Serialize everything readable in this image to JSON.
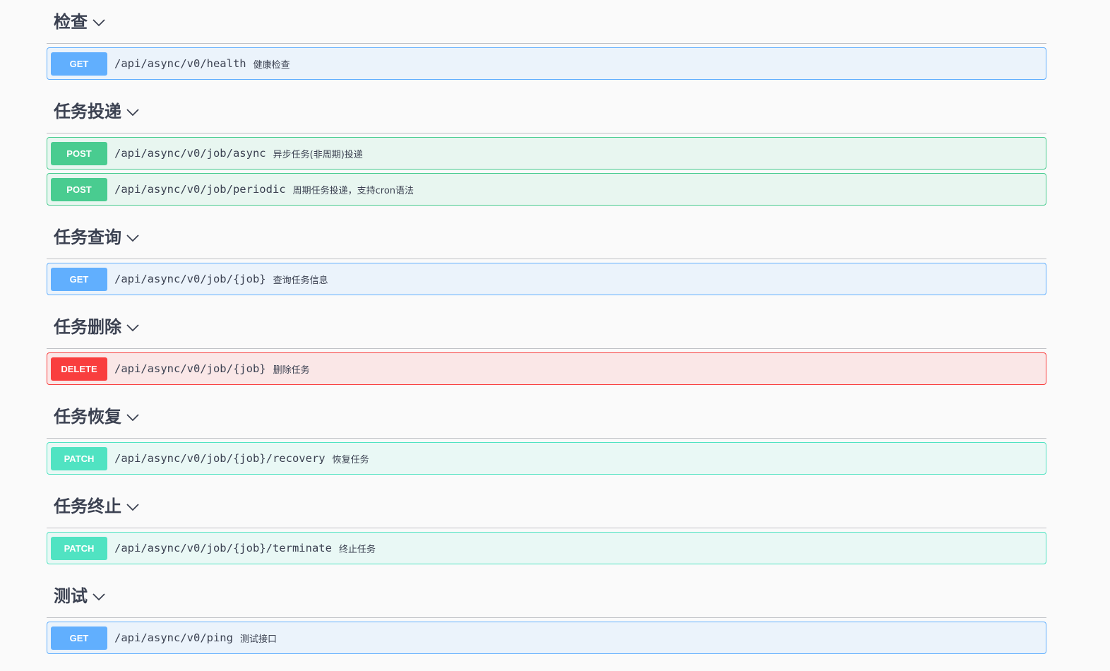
{
  "colors": {
    "get": {
      "bg": "#ebf3fb",
      "border": "#61affe",
      "badge": "#61affe"
    },
    "post": {
      "bg": "#e8f6f0",
      "border": "#49cc90",
      "badge": "#49cc90"
    },
    "delete": {
      "bg": "#fae7e7",
      "border": "#f93e3e",
      "badge": "#f93e3e"
    },
    "patch": {
      "bg": "#e9f8f5",
      "border": "#50e3c2",
      "badge": "#50e3c2"
    }
  },
  "tags": [
    {
      "name": "检查",
      "icon": "chevron-down-icon",
      "operations": [
        {
          "method": "GET",
          "type": "get",
          "path": "/api/async/v0/health",
          "summary": "健康检查"
        }
      ]
    },
    {
      "name": "任务投递",
      "icon": "chevron-down-icon",
      "operations": [
        {
          "method": "POST",
          "type": "post",
          "path": "/api/async/v0/job/async",
          "summary": "异步任务(非周期)投递"
        },
        {
          "method": "POST",
          "type": "post",
          "path": "/api/async/v0/job/periodic",
          "summary": "周期任务投递，支持cron语法"
        }
      ]
    },
    {
      "name": "任务查询",
      "icon": "chevron-down-icon",
      "operations": [
        {
          "method": "GET",
          "type": "get",
          "path": "/api/async/v0/job/{job}",
          "summary": "查询任务信息"
        }
      ]
    },
    {
      "name": "任务删除",
      "icon": "chevron-down-icon",
      "operations": [
        {
          "method": "DELETE",
          "type": "delete",
          "path": "/api/async/v0/job/{job}",
          "summary": "删除任务"
        }
      ]
    },
    {
      "name": "任务恢复",
      "icon": "chevron-down-icon",
      "operations": [
        {
          "method": "PATCH",
          "type": "patch",
          "path": "/api/async/v0/job/{job}/recovery",
          "summary": "恢复任务"
        }
      ]
    },
    {
      "name": "任务终止",
      "icon": "chevron-down-icon",
      "operations": [
        {
          "method": "PATCH",
          "type": "patch",
          "path": "/api/async/v0/job/{job}/terminate",
          "summary": "终止任务"
        }
      ]
    },
    {
      "name": "测试",
      "icon": "chevron-down-icon",
      "operations": [
        {
          "method": "GET",
          "type": "get",
          "path": "/api/async/v0/ping",
          "summary": "测试接口"
        }
      ]
    }
  ]
}
